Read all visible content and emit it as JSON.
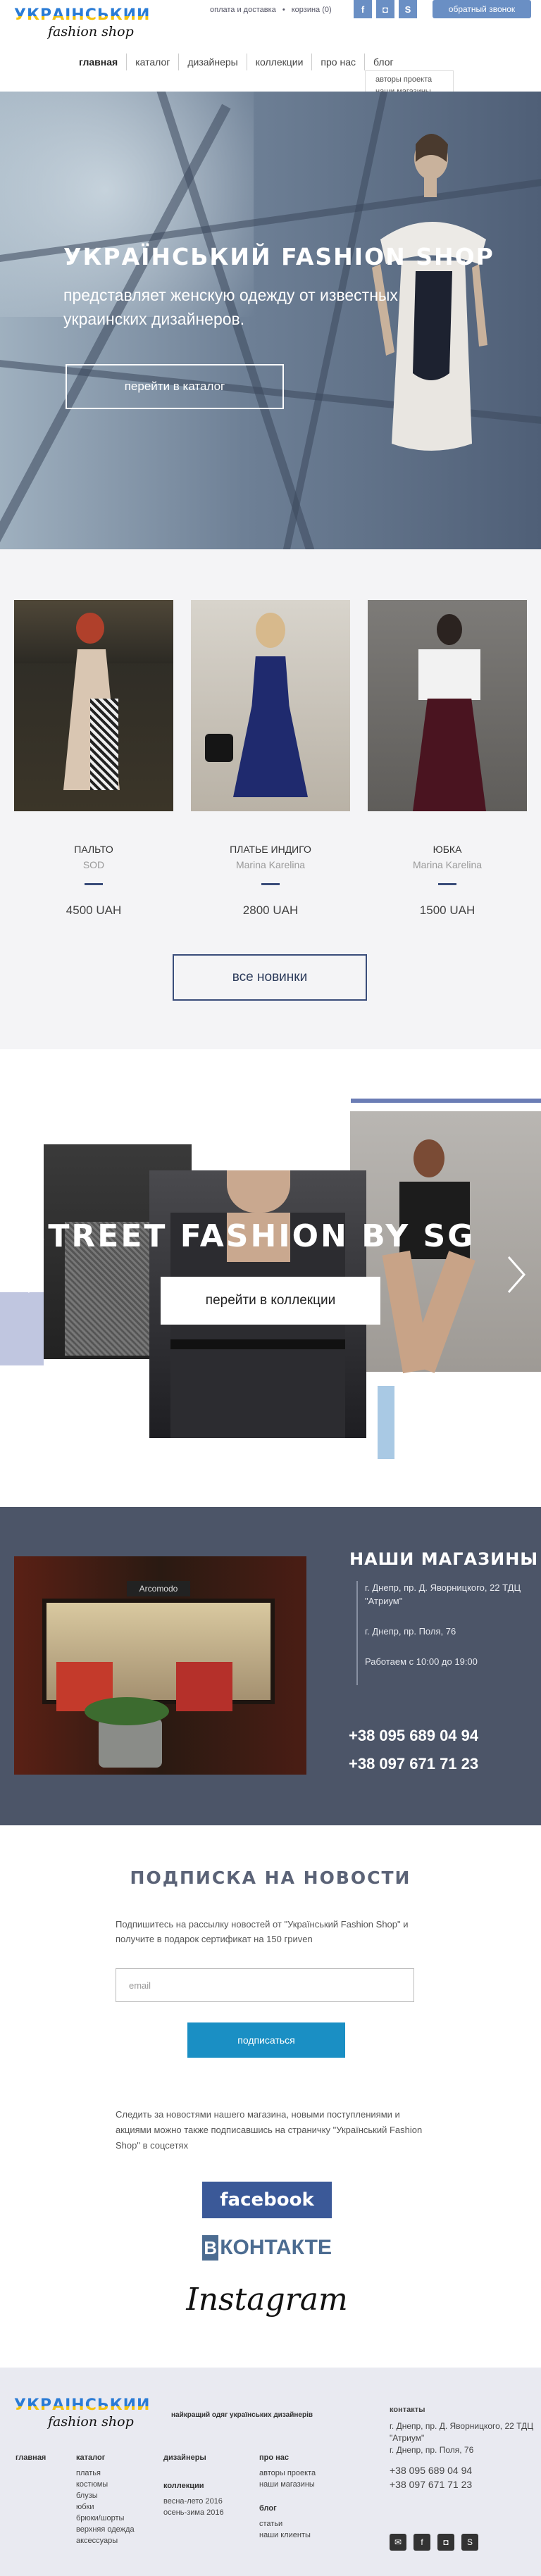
{
  "header": {
    "logo_line1": "УКРАЇНСЬКИЙ",
    "logo_line2": "fashion shop",
    "top_links": [
      "оплата и доставка",
      "•",
      "корзина (0)"
    ],
    "social": [
      {
        "icon": "facebook-icon",
        "glyph": "f"
      },
      {
        "icon": "instagram-icon",
        "glyph": "◘"
      },
      {
        "icon": "skype-icon",
        "glyph": "S"
      }
    ],
    "callback_label": "обратный звонок",
    "nav": [
      "главная",
      "каталог",
      "дизайнеры",
      "коллекции",
      "про нас",
      "блог"
    ],
    "dropdown": [
      "авторы проекта",
      "наши магазины"
    ]
  },
  "hero": {
    "title": "УКРАЇНСЬКИЙ FASHION SHOP",
    "subtitle": "представляет женскую одежду от известных украинских дизайнеров.",
    "button": "перейти в каталог"
  },
  "products": {
    "items": [
      {
        "name": "ПАЛЬТО",
        "brand": "SOD",
        "price": "4500 UAH"
      },
      {
        "name": "ПЛАТЬЕ ИНДИГО",
        "brand": "Marina Karelina",
        "price": "2800 UAH"
      },
      {
        "name": "ЮБКА",
        "brand": "Marina Karelina",
        "price": "1500 UAH"
      }
    ],
    "all_button": "все новинки"
  },
  "collection": {
    "title": "STREET FASHION BY SG",
    "button": "перейти в коллекции"
  },
  "stores": {
    "title": "НАШИ МАГАЗИНЫ",
    "addresses": [
      "г. Днепр, пр. Д. Яворницкого, 22 ТДЦ \"Атриум\"",
      "г. Днепр, пр. Поля, 76",
      "Работаем с 10:00 до 19:00"
    ],
    "phones": [
      "+38 095 689 04 94",
      "+38 097 671 71 23"
    ],
    "sign": "Arcomodo"
  },
  "subscribe": {
    "title": "ПОДПИСКА НА НОВОСТИ",
    "text": "Подпишитесь на рассылку новостей от \"Український Fashion Shop\" и получите в подарок сертификат на 150 гриven",
    "email_placeholder": "email",
    "button": "подписаться",
    "follow_text": "Следить за новостями нашего магазина, новыми поступлениями и акциями можно также подписавшись на страничку \"Український Fashion Shop\" в соцсетях",
    "facebook": "facebook",
    "vk_letter": "В",
    "vk_rest": "КОНТАКТЕ",
    "instagram": "Instagram"
  },
  "footer": {
    "tagline": "найкращий одяг українських дизайнерів",
    "col_main": {
      "heading": "главная"
    },
    "col_catalog": {
      "heading": "каталог",
      "items": [
        "платья",
        "костюмы",
        "блузы",
        "юбки",
        "брюки/шорты",
        "верхняя одежда",
        "аксессуары"
      ]
    },
    "col_designers": {
      "heading": "дизайнеры"
    },
    "col_collections": {
      "heading": "коллекции",
      "items": [
        "весна-лето 2016",
        "осень-зима 2016"
      ]
    },
    "col_about": {
      "heading": "про нас",
      "items": [
        "авторы проекта",
        "наши магазины"
      ]
    },
    "col_blog": {
      "heading": "блог",
      "items": [
        "статьи",
        "наши клиенты"
      ]
    },
    "contacts": {
      "heading": "контакты",
      "addresses": [
        "г. Днепр, пр. Д. Яворницкого, 22 ТДЦ \"Атриум\"",
        "г. Днепр, пр. Поля, 76"
      ],
      "phones": [
        "+38 095 689 04 94",
        "+38 097 671 71 23"
      ]
    },
    "social": [
      {
        "icon": "mail-icon",
        "glyph": "✉"
      },
      {
        "icon": "facebook-icon",
        "glyph": "f"
      },
      {
        "icon": "instagram-icon",
        "glyph": "◘"
      },
      {
        "icon": "skype-icon",
        "glyph": "S"
      }
    ]
  }
}
